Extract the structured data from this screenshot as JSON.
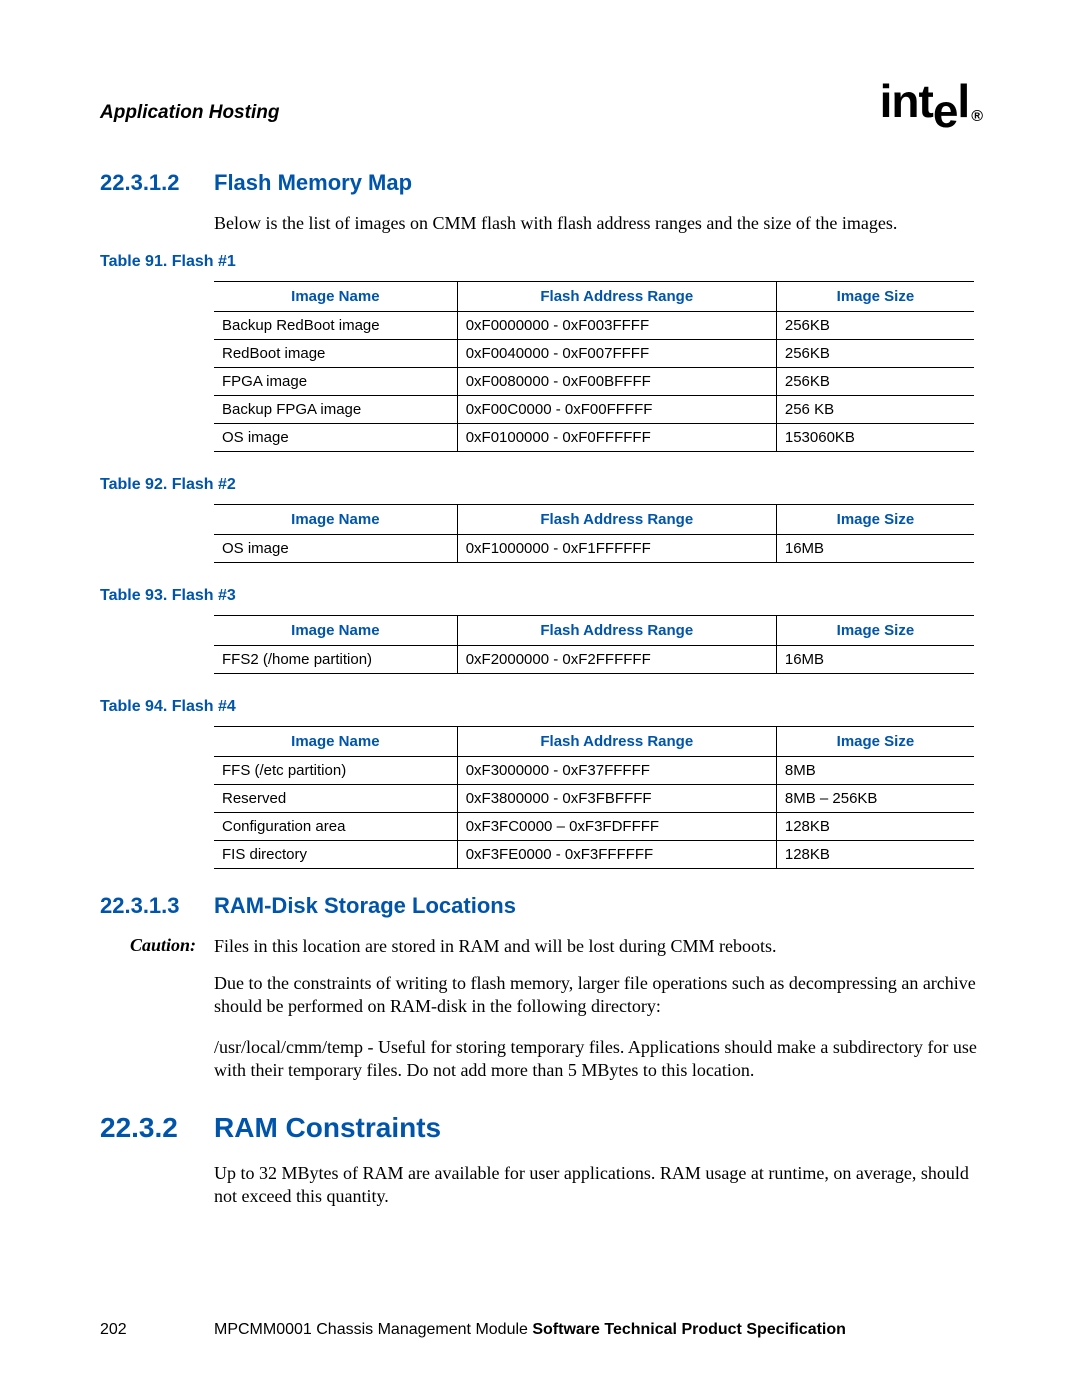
{
  "header": {
    "chapter": "Application Hosting",
    "logo_text": "intel",
    "logo_r": "®"
  },
  "section_22312": {
    "num": "22.3.1.2",
    "title": "Flash Memory Map",
    "intro": "Below is the list of images on CMM flash with flash address ranges and the size of the images."
  },
  "table_headers": {
    "name": "Image Name",
    "range": "Flash Address Range",
    "size": "Image Size"
  },
  "table91": {
    "caption": "Table 91. Flash #1",
    "rows": [
      {
        "name": "Backup RedBoot image",
        "range": "0xF0000000 - 0xF003FFFF",
        "size": "256KB"
      },
      {
        "name": "RedBoot image",
        "range": "0xF0040000 - 0xF007FFFF",
        "size": "256KB"
      },
      {
        "name": "FPGA image",
        "range": "0xF0080000 - 0xF00BFFFF",
        "size": "256KB"
      },
      {
        "name": "Backup FPGA image",
        "range": "0xF00C0000 - 0xF00FFFFF",
        "size": "256 KB"
      },
      {
        "name": "OS image",
        "range": "0xF0100000 - 0xF0FFFFFF",
        "size": "153060KB"
      }
    ]
  },
  "table92": {
    "caption": "Table 92. Flash #2",
    "rows": [
      {
        "name": "OS image",
        "range": "0xF1000000 - 0xF1FFFFFF",
        "size": "16MB"
      }
    ]
  },
  "table93": {
    "caption": "Table 93. Flash #3",
    "rows": [
      {
        "name": "FFS2 (/home partition)",
        "range": "0xF2000000 - 0xF2FFFFFF",
        "size": "16MB"
      }
    ]
  },
  "table94": {
    "caption": "Table 94. Flash #4",
    "rows": [
      {
        "name": "FFS (/etc partition)",
        "range": "0xF3000000 - 0xF37FFFFF",
        "size": "8MB"
      },
      {
        "name": "Reserved",
        "range": "0xF3800000 - 0xF3FBFFFF",
        "size": "8MB – 256KB"
      },
      {
        "name": "Configuration area",
        "range": "0xF3FC0000 – 0xF3FDFFFF",
        "size": "128KB"
      },
      {
        "name": "FIS directory",
        "range": "0xF3FE0000 - 0xF3FFFFFF",
        "size": "128KB"
      }
    ]
  },
  "section_22313": {
    "num": "22.3.1.3",
    "title": "RAM-Disk Storage Locations",
    "caution_label": "Caution:",
    "caution_text": "Files in this location are stored in RAM and will be lost during CMM reboots.",
    "para1": "Due to the constraints of writing to flash memory, larger file operations such as decompressing an archive should be performed on RAM-disk in the following directory:",
    "para2": "/usr/local/cmm/temp - Useful for storing temporary files. Applications should make a subdirectory for use with their temporary files. Do not add more than 5 MBytes to this location."
  },
  "section_2232": {
    "num": "22.3.2",
    "title": "RAM Constraints",
    "para": "Up to 32 MBytes of RAM are available for user applications. RAM usage at runtime, on average, should not exceed this quantity."
  },
  "footer": {
    "page": "202",
    "doc_a": "MPCMM0001 Chassis Management Module ",
    "doc_b": "Software Technical Product Specification"
  }
}
